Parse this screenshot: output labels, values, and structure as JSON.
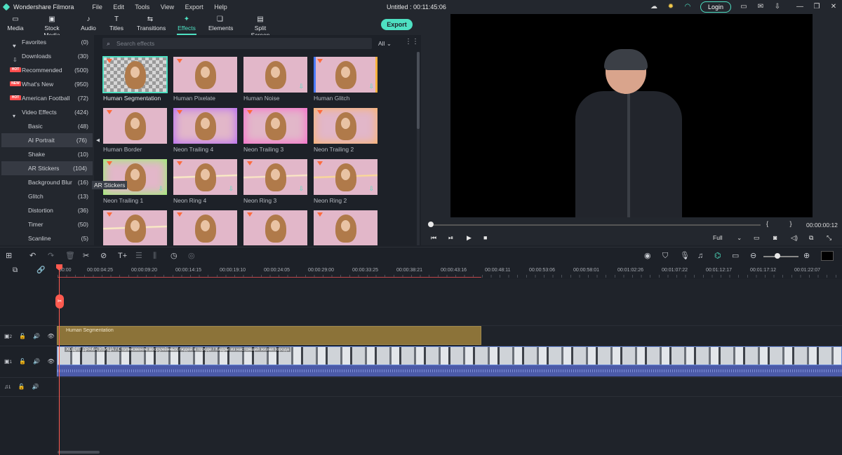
{
  "titlebar": {
    "app_name": "Wondershare Filmora",
    "menu": [
      "File",
      "Edit",
      "Tools",
      "View",
      "Export",
      "Help"
    ],
    "document": "Untitled : 00:11:45:06",
    "login_label": "Login"
  },
  "tabs": [
    {
      "label": "Media",
      "icon": "folder-icon"
    },
    {
      "label": "Stock Media",
      "icon": "stock-media-icon"
    },
    {
      "label": "Audio",
      "icon": "music-note-icon"
    },
    {
      "label": "Titles",
      "icon": "text-icon"
    },
    {
      "label": "Transitions",
      "icon": "transitions-icon"
    },
    {
      "label": "Effects",
      "icon": "effects-icon",
      "active": true
    },
    {
      "label": "Elements",
      "icon": "elements-icon"
    },
    {
      "label": "Split Screen",
      "icon": "split-screen-icon"
    }
  ],
  "export_label": "Export",
  "sidebar": {
    "items": [
      {
        "label": "Favorites",
        "count": "(0)"
      },
      {
        "label": "Downloads",
        "count": "(30)"
      },
      {
        "label": "Recommended",
        "count": "(500)",
        "badge": "HOT"
      },
      {
        "label": "What's New",
        "count": "(950)",
        "badge": "NEW"
      },
      {
        "label": "American Football",
        "count": "(72)",
        "badge": "HOT"
      },
      {
        "label": "Video Effects",
        "count": "(424)"
      },
      {
        "label": "Basic",
        "count": "(48)"
      },
      {
        "label": "AI Portrait",
        "count": "(76)"
      },
      {
        "label": "Shake",
        "count": "(10)"
      },
      {
        "label": "AR Stickers",
        "count": "(104)"
      },
      {
        "label": "Background Blur",
        "count": "(16)"
      },
      {
        "label": "Glitch",
        "count": "(13)"
      },
      {
        "label": "Distortion",
        "count": "(36)"
      },
      {
        "label": "Timer",
        "count": "(50)"
      },
      {
        "label": "Scanline",
        "count": "(5)"
      }
    ],
    "tooltip": "AR Stickers"
  },
  "effects": {
    "search_placeholder": "Search effects",
    "filter": "All",
    "items": [
      "Human Segmentation",
      "Human Pixelate",
      "Human Noise",
      "Human Glitch",
      "Human Border",
      "Neon Trailing 4",
      "Neon Trailing 3",
      "Neon Trailing 2",
      "Neon Trailing 1",
      "Neon Ring 4",
      "Neon Ring 3",
      "Neon Ring 2"
    ]
  },
  "preview": {
    "time": "00:00:00:12",
    "marks": "{ }",
    "zoom": "Full"
  },
  "ruler": [
    "00:00",
    "00:00:04:25",
    "00:00:09:20",
    "00:00:14:15",
    "00:00:19:10",
    "00:00:24:05",
    "00:00:29:00",
    "00:00:33:25",
    "00:00:38:21",
    "00:00:43:16",
    "00:00:48:11",
    "00:00:53:06",
    "00:00:58:01",
    "00:01:02:26",
    "00:01:07:22",
    "00:01:12:17",
    "00:01:17:12",
    "00:01:22:07"
  ],
  "tracks": {
    "fx_track": "2",
    "video_track": "1",
    "audio_track": "1",
    "fx_clip_label": "Human Segmentation",
    "video_clip_label": "ХОДЯТ ДРАКА УЛИЦА / Столкновение вооружённых людей в городе / Кадры из настоящей жизни города"
  },
  "colors": {
    "accent": "#4ee0c2",
    "playhead": "#ff5a4f",
    "fx_clip": "#8c7339",
    "audio": "#4b5aa8"
  }
}
